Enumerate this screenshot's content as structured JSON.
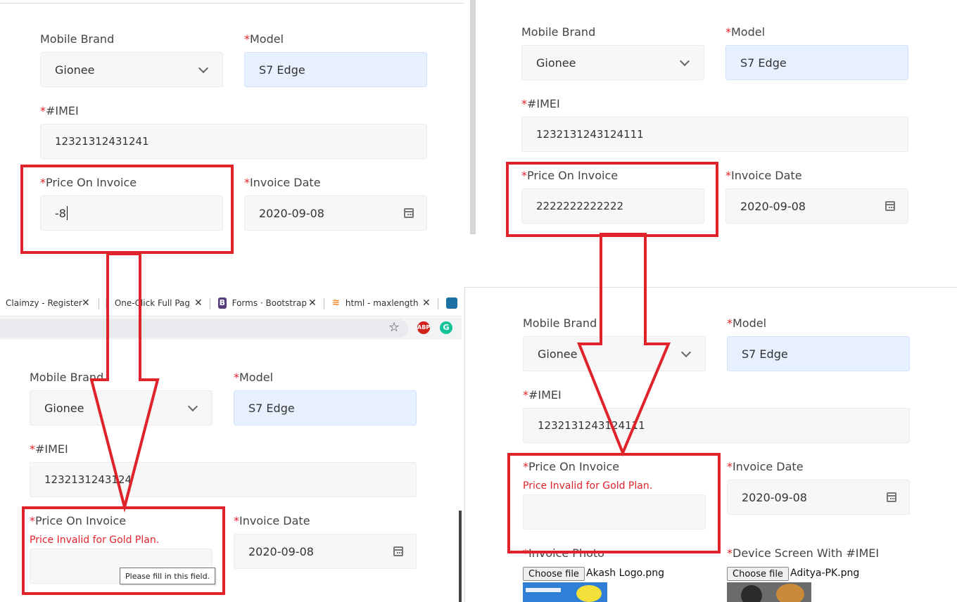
{
  "panels": [
    {
      "mobile_brand_label": "Mobile Brand",
      "mobile_brand_value": "Gionee",
      "model_label": "Model",
      "model_value": "S7 Edge",
      "imei_label": "#IMEI",
      "imei_value": "12321312431241",
      "price_label": "Price On Invoice",
      "price_value": "-8",
      "invoice_date_label": "Invoice Date",
      "invoice_date_value": "2020-09-08"
    },
    {
      "mobile_brand_label": "Mobile Brand",
      "mobile_brand_value": "Gionee",
      "model_label": "Model",
      "model_value": "S7 Edge",
      "imei_label": "#IMEI",
      "imei_value": "1232131243124111",
      "price_label": "Price On Invoice",
      "price_value": "2222222222222",
      "invoice_date_label": "Invoice Date",
      "invoice_date_value": "2020-09-08"
    },
    {
      "mobile_brand_label": "Mobile Brand",
      "mobile_brand_value": "Gionee",
      "model_label": "Model",
      "model_value": "S7 Edge",
      "imei_label": "#IMEI",
      "imei_value": "1232131243124",
      "price_label": "Price On Invoice",
      "price_error": "Price Invalid for Gold Plan.",
      "price_value": "",
      "invoice_date_label": "Invoice Date",
      "invoice_date_value": "2020-09-08",
      "tooltip": "Please fill in this field."
    },
    {
      "mobile_brand_label": "Mobile Brand",
      "mobile_brand_value": "Gionee",
      "model_label": "Model",
      "model_value": "S7 Edge",
      "imei_label": "#IMEI",
      "imei_value": "1232131243124111",
      "price_label": "Price On Invoice",
      "price_error": "Price Invalid for Gold Plan.",
      "price_value": "",
      "invoice_date_label": "Invoice Date",
      "invoice_date_value": "2020-09-08",
      "invoice_photo_label": "Invoice Photo",
      "invoice_photo_button": "Choose file",
      "invoice_photo_file": "Akash Logo.png",
      "device_screen_label": "Device Screen With #IMEI",
      "device_screen_button": "Choose file",
      "device_screen_file": "Aditya-PK.png"
    }
  ],
  "required_marker": "*",
  "browser": {
    "tabs": [
      {
        "title": "Claimzy - Register",
        "close": "✕"
      },
      {
        "title": "One-Click Full Pag",
        "close": "✕"
      },
      {
        "title": "Forms · Bootstrap",
        "close": "✕",
        "favicon": "B"
      },
      {
        "title": "html - maxlength i",
        "close": "✕"
      }
    ],
    "abp_icon": "ABP",
    "grammarly_icon": "G",
    "star_icon": "☆"
  },
  "colors": {
    "highlight": "#e0232b",
    "required": "#e0232b",
    "model_field_bg": "#e7f0fe",
    "field_bg": "#f7f7f7",
    "bootstrap_purple": "#563d7c"
  }
}
